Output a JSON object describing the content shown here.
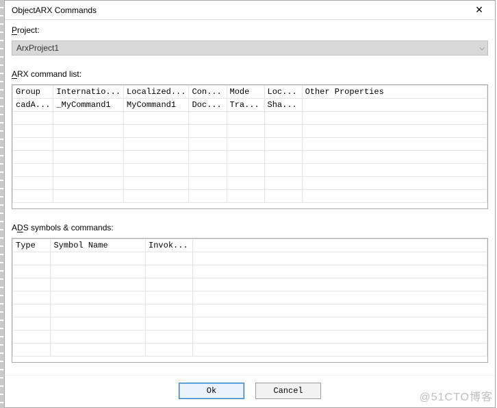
{
  "window": {
    "title": "ObjectARX Commands"
  },
  "project": {
    "label_html": "Project:",
    "accel_char": "P",
    "value": "ArxProject1"
  },
  "arx": {
    "label": "ARX command list:",
    "accel_char": "A",
    "columns": [
      "Group",
      "Internatio...",
      "Localized...",
      "Con...",
      "Mode",
      "Loc...",
      "Other Properties"
    ],
    "rows": [
      {
        "group": "cadA...",
        "intl": "_MyCommand1",
        "local": "MyCommand1",
        "context": "Doc...",
        "mode": "Tra...",
        "lock": "Sha...",
        "other": ""
      }
    ],
    "blank_rows": 7,
    "col_widths_pct": [
      8,
      13,
      13,
      8,
      8,
      8,
      42
    ]
  },
  "ads": {
    "label": "ADS symbols & commands:",
    "accel_char": "D",
    "columns": [
      "Type",
      "Symbol Name",
      "Invok..."
    ],
    "rows": [],
    "blank_rows": 8,
    "col_widths_pct": [
      8,
      20,
      10
    ]
  },
  "buttons": {
    "ok": "Ok",
    "cancel": "Cancel"
  },
  "watermark": "@51CTO博客"
}
